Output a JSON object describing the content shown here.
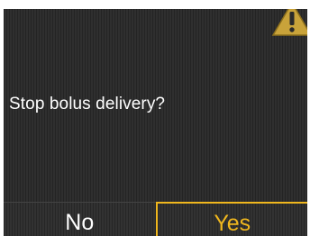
{
  "dialog": {
    "prompt": "Stop bolus delivery?",
    "icon": "warning-icon"
  },
  "softkeys": {
    "left_label": "No",
    "right_label": "Yes"
  },
  "colors": {
    "background": "#2b2b2b",
    "text": "#ffffff",
    "accent": "#f0b71e",
    "warning_fill": "#c9a33a"
  }
}
